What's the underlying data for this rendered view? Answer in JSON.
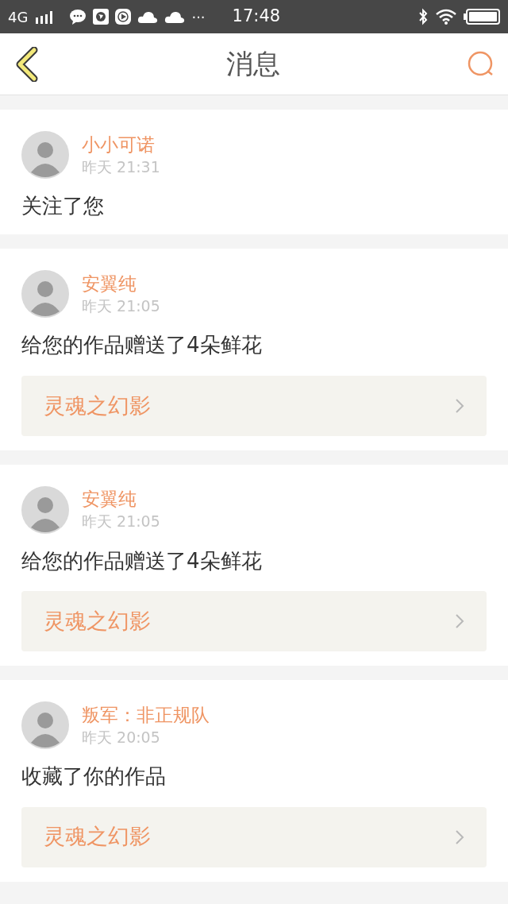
{
  "status_bar": {
    "network": "4G",
    "more": "···",
    "time": "17:48"
  },
  "header": {
    "title": "消息"
  },
  "messages": [
    {
      "user": "小小可诺",
      "time": "昨天 21:31",
      "text": "关注了您"
    },
    {
      "user": "安翼纯",
      "time": "昨天 21:05",
      "text": "给您的作品赠送了4朵鲜花",
      "work": "灵魂之幻影"
    },
    {
      "user": "安翼纯",
      "time": "昨天 21:05",
      "text": "给您的作品赠送了4朵鲜花",
      "work": "灵魂之幻影"
    },
    {
      "user": "叛军：非正规队",
      "time": "昨天 20:05",
      "text": "收藏了你的作品",
      "work": "灵魂之幻影"
    }
  ]
}
